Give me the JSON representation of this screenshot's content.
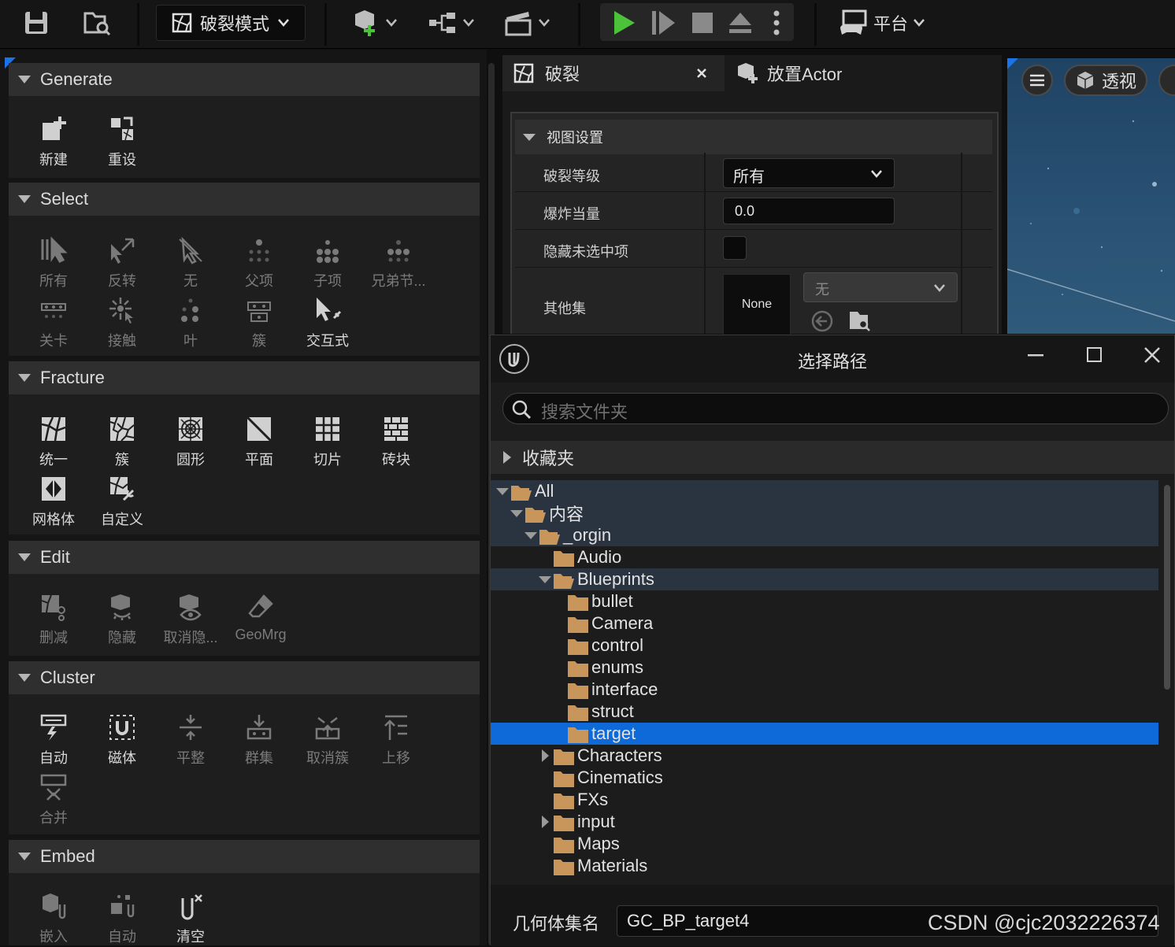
{
  "toolbar": {
    "mode": "破裂模式",
    "platform": "平台"
  },
  "left_panel": {
    "sections": [
      {
        "title": "Generate",
        "tools": [
          "新建",
          "重设"
        ]
      },
      {
        "title": "Select",
        "tools": [
          "所有",
          "反转",
          "无",
          "父项",
          "子项",
          "兄弟节...",
          "关卡",
          "接触",
          "叶",
          "簇",
          "交互式"
        ]
      },
      {
        "title": "Fracture",
        "tools": [
          "统一",
          "簇",
          "圆形",
          "平面",
          "切片",
          "砖块",
          "网格体",
          "自定义"
        ]
      },
      {
        "title": "Edit",
        "tools": [
          "删减",
          "隐藏",
          "取消隐...",
          "GeoMrg"
        ]
      },
      {
        "title": "Cluster",
        "tools": [
          "自动",
          "磁体",
          "平整",
          "群集",
          "取消簇",
          "上移",
          "合并"
        ]
      },
      {
        "title": "Embed",
        "tools": [
          "嵌入",
          "自动",
          "清空"
        ]
      }
    ]
  },
  "fracture_panel": {
    "tabs": [
      "破裂",
      "放置Actor"
    ],
    "section_title": "视图设置",
    "rows": {
      "level_label": "破裂等级",
      "level_value": "所有",
      "explode_label": "爆炸当量",
      "explode_value": "0.0",
      "hide_label": "隐藏未选中项",
      "other_label": "其他集",
      "other_thumb": "None",
      "other_value": "无"
    }
  },
  "viewport": {
    "perspective": "透视"
  },
  "dialog": {
    "title": "选择路径",
    "search_placeholder": "搜索文件夹",
    "favorites": "收藏夹",
    "tree": [
      {
        "label": "All",
        "depth": 0,
        "state": "open"
      },
      {
        "label": "内容",
        "depth": 1,
        "state": "open"
      },
      {
        "label": "_orgin",
        "depth": 2,
        "state": "open"
      },
      {
        "label": "Audio",
        "depth": 3,
        "state": "leaf"
      },
      {
        "label": "Blueprints",
        "depth": 3,
        "state": "open"
      },
      {
        "label": "bullet",
        "depth": 4,
        "state": "leaf"
      },
      {
        "label": "Camera",
        "depth": 4,
        "state": "leaf"
      },
      {
        "label": "control",
        "depth": 4,
        "state": "leaf"
      },
      {
        "label": "enums",
        "depth": 4,
        "state": "leaf"
      },
      {
        "label": "interface",
        "depth": 4,
        "state": "leaf"
      },
      {
        "label": "struct",
        "depth": 4,
        "state": "leaf"
      },
      {
        "label": "target",
        "depth": 4,
        "state": "selected"
      },
      {
        "label": "Characters",
        "depth": 3,
        "state": "closed"
      },
      {
        "label": "Cinematics",
        "depth": 3,
        "state": "leaf"
      },
      {
        "label": "FXs",
        "depth": 3,
        "state": "leaf"
      },
      {
        "label": "input",
        "depth": 3,
        "state": "closed"
      },
      {
        "label": "Maps",
        "depth": 3,
        "state": "leaf"
      },
      {
        "label": "Materials",
        "depth": 3,
        "state": "leaf"
      }
    ],
    "name_label": "几何体集名",
    "name_value": "GC_BP_target4"
  },
  "watermark": "CSDN @cjc2032226374",
  "colors": {
    "accent_green": "#4cc23a",
    "selection_blue": "#0e6ad9",
    "folder": "#c8955a",
    "viewport_blue": "#2a5274"
  }
}
